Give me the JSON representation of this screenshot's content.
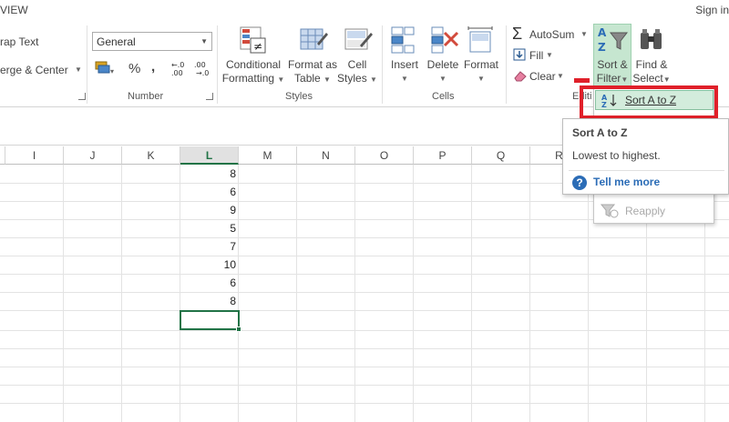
{
  "tabs": {
    "view": "VIEW",
    "signin": "Sign in"
  },
  "alignment": {
    "wrap_text": "rap Text",
    "merge_center": "erge & Center"
  },
  "number": {
    "format_value": "General",
    "percent": "%",
    "comma": ",",
    "group_label": "Number"
  },
  "styles": {
    "conditional_line1": "Conditional",
    "conditional_line2": "Formatting",
    "format_table_line1": "Format as",
    "format_table_line2": "Table",
    "cell_styles_line1": "Cell",
    "cell_styles_line2": "Styles",
    "group_label": "Styles"
  },
  "cells": {
    "insert": "Insert",
    "delete": "Delete",
    "format": "Format",
    "group_label": "Cells"
  },
  "editing": {
    "autosum": "AutoSum",
    "fill": "Fill",
    "clear": "Clear",
    "sort_line1": "Sort &",
    "sort_line2": "Filter",
    "find_line1": "Find &",
    "find_line2": "Select",
    "group_label_partial": "Editi"
  },
  "columns": [
    "I",
    "J",
    "K",
    "L",
    "M",
    "N",
    "O",
    "P",
    "Q",
    "R"
  ],
  "selected_column": "L",
  "column_l_values": [
    "8",
    "6",
    "9",
    "5",
    "7",
    "10",
    "6",
    "8"
  ],
  "dropdown": {
    "sort_az": "Sort A to Z",
    "reapply": "Reapply"
  },
  "tooltip": {
    "title": "Sort A to Z",
    "description": "Lowest to highest.",
    "tell_more": "Tell me more",
    "help_glyph": "?"
  },
  "colors": {
    "excel_green": "#217346",
    "highlight_red": "#e0202a",
    "link_blue": "#2b6cb6"
  }
}
